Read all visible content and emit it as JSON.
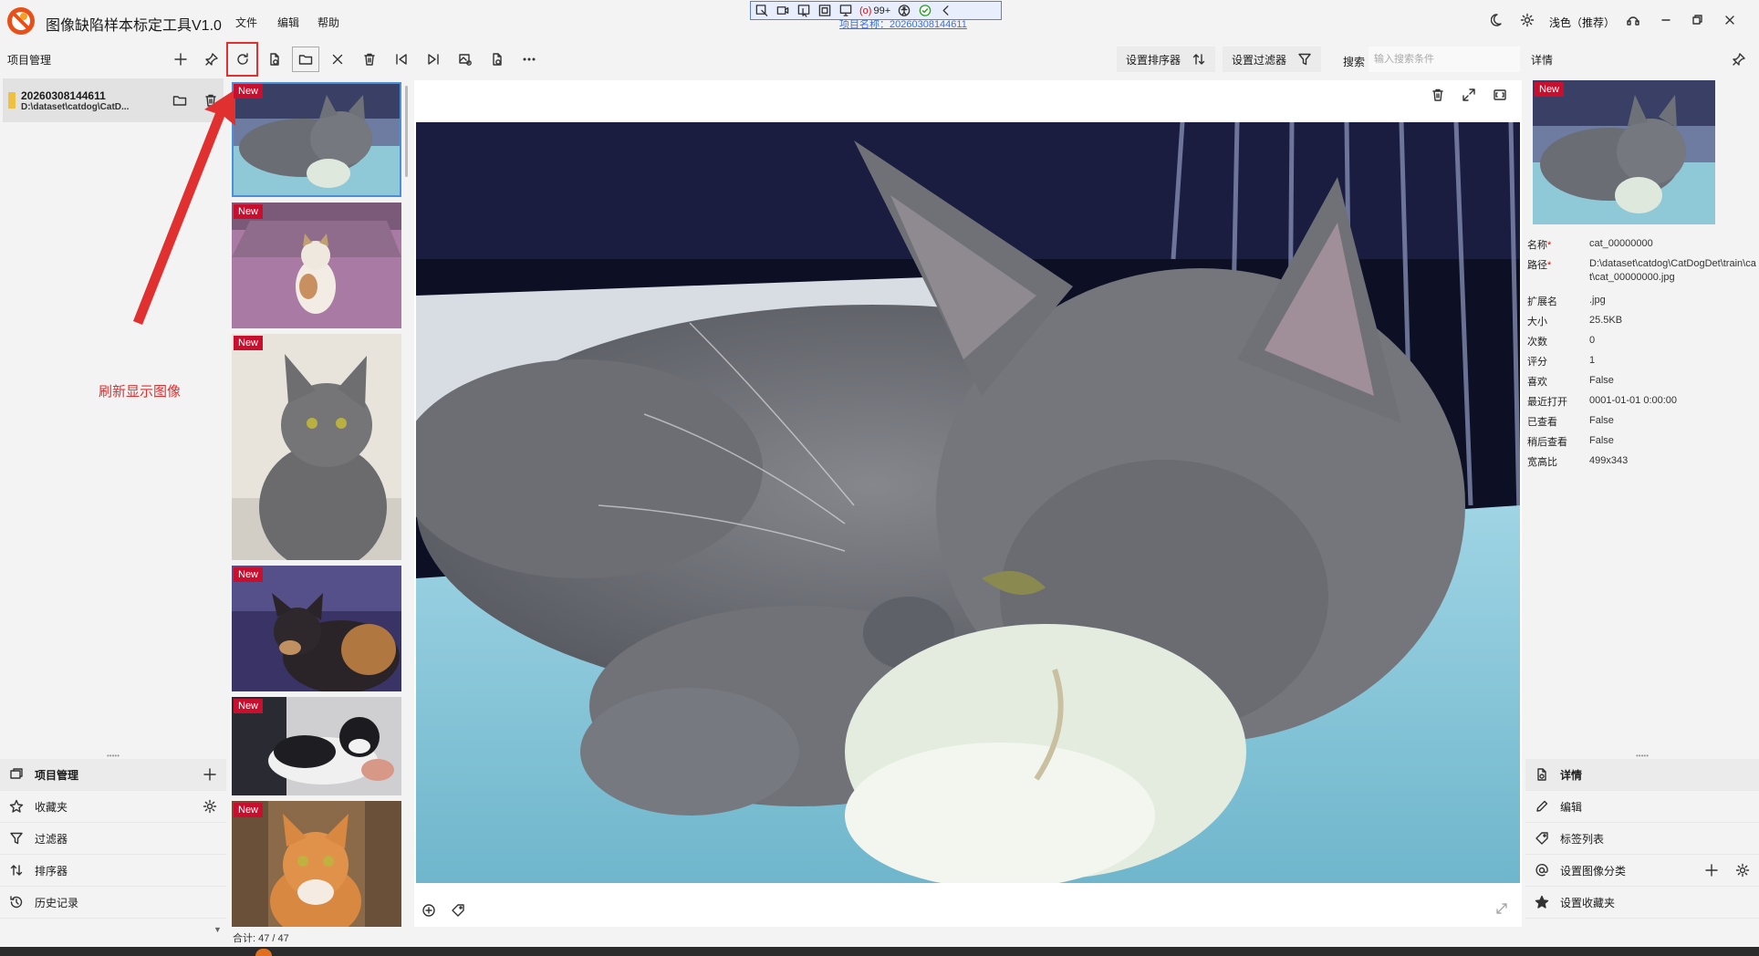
{
  "app": {
    "title": "图像缺陷样本标定工具V1.0",
    "menus": [
      "文件",
      "编辑",
      "帮助"
    ],
    "project_name_top": "项目名称：20260308144611",
    "badge_count": "99+",
    "theme": "浅色（推荐）"
  },
  "left_panel": {
    "header": "项目管理",
    "project": {
      "name": "20260308144611",
      "path": "D:\\dataset\\catdog\\CatD..."
    },
    "nav": [
      {
        "label": "项目管理",
        "icon": "projects-icon"
      },
      {
        "label": "收藏夹",
        "icon": "star-outline-icon"
      },
      {
        "label": "过滤器",
        "icon": "filter-icon"
      },
      {
        "label": "排序器",
        "icon": "sort-icon"
      },
      {
        "label": "历史记录",
        "icon": "history-icon"
      }
    ]
  },
  "toolbar": {
    "sort_label": "设置排序器",
    "filter_label": "设置过滤器",
    "search_label": "搜索",
    "search_placeholder": "输入搜索条件"
  },
  "thumbnails": {
    "new_badge": "New",
    "total": "合计:   47 / 47",
    "items": [
      {
        "subject": "gray kitten"
      },
      {
        "subject": "calico kitten"
      },
      {
        "subject": "gray cat"
      },
      {
        "subject": "tortoiseshell cat"
      },
      {
        "subject": "black white kitten"
      },
      {
        "subject": "orange tabby kitten"
      }
    ]
  },
  "right_panel": {
    "header": "详情",
    "new_badge": "New",
    "props": [
      {
        "key": "名称",
        "required": "*",
        "value": "cat_00000000"
      },
      {
        "key": "路径",
        "required": "*",
        "value": "D:\\dataset\\catdog\\CatDogDet\\train\\cat\\cat_00000000.jpg"
      },
      {
        "key": "扩展名",
        "required": "",
        "value": ".jpg"
      },
      {
        "key": "大小",
        "required": "",
        "value": "25.5KB"
      },
      {
        "key": "次数",
        "required": "",
        "value": "0"
      },
      {
        "key": "评分",
        "required": "",
        "value": "1"
      },
      {
        "key": "喜欢",
        "required": "",
        "value": "False"
      },
      {
        "key": "最近打开",
        "required": "",
        "value": "0001-01-01 0:00:00"
      },
      {
        "key": "已查看",
        "required": "",
        "value": "False"
      },
      {
        "key": "稍后查看",
        "required": "",
        "value": "False"
      },
      {
        "key": "宽高比",
        "required": "",
        "value": "499x343"
      }
    ],
    "nav": [
      {
        "label": "详情"
      },
      {
        "label": "编辑"
      },
      {
        "label": "标签列表"
      },
      {
        "label": "设置图像分类"
      },
      {
        "label": "设置收藏夹"
      }
    ]
  },
  "annotation": {
    "label": "刷新显示图像",
    "color": "#e03030"
  },
  "colors": {
    "new_badge": "#c8102e",
    "accent": "#3b6fe0",
    "selected_outline": "#4a90d9"
  }
}
